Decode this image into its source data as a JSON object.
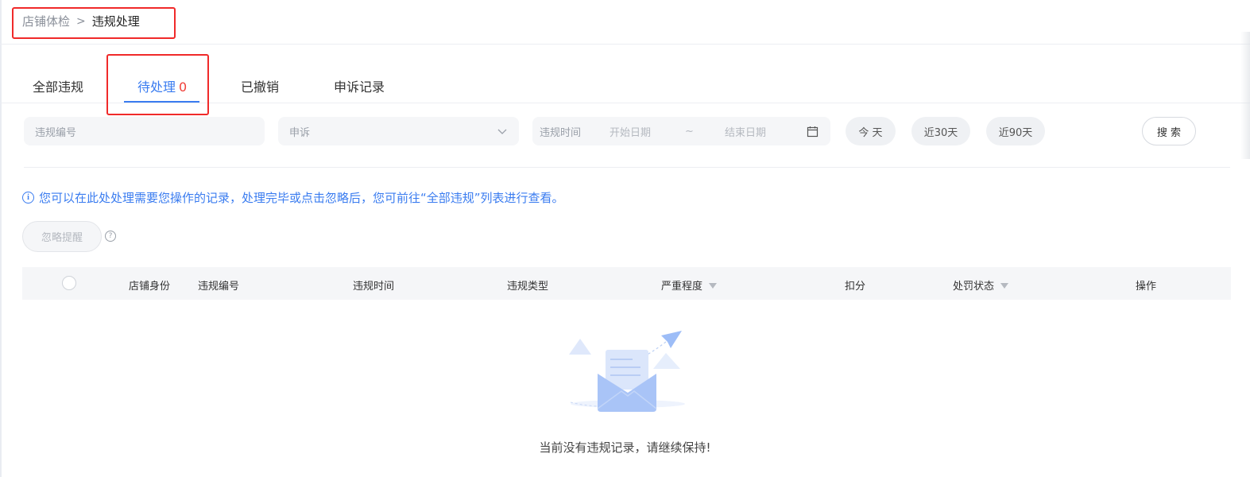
{
  "breadcrumb": {
    "parent": "店铺体检",
    "separator": ">",
    "current": "违规处理"
  },
  "tabs": [
    {
      "label": "全部违规"
    },
    {
      "label": "待处理",
      "count": "0"
    },
    {
      "label": "已撤销"
    },
    {
      "label": "申诉记录"
    }
  ],
  "filters": {
    "violation_number_placeholder": "违规编号",
    "appeal_select_placeholder": "申诉",
    "time_label": "违规时间",
    "start_date_placeholder": "开始日期",
    "range_separator": "~",
    "end_date_placeholder": "结束日期",
    "today": "今 天",
    "last30": "近30天",
    "last90": "近90天",
    "search": "搜 索"
  },
  "notice": "您可以在此处处理需要您操作的记录，处理完毕或点击忽略后，您可前往“全部违规”列表进行查看。",
  "ignore_button": "忽略提醒",
  "help_icon_glyph": "?",
  "table": {
    "columns": [
      "店铺身份",
      "违规编号",
      "违规时间",
      "违规类型",
      "严重程度",
      "扣分",
      "处罚状态",
      "操作"
    ]
  },
  "empty_text": "当前没有违规记录，请继续保持!",
  "colors": {
    "accent": "#3a7cf0",
    "count_red": "#f0403a",
    "highlight_box": "#f02a2a"
  },
  "icons": [
    "info-icon",
    "chevron-down-icon",
    "calendar-icon",
    "help-icon",
    "filter-icon",
    "empty-mail-illustration"
  ]
}
